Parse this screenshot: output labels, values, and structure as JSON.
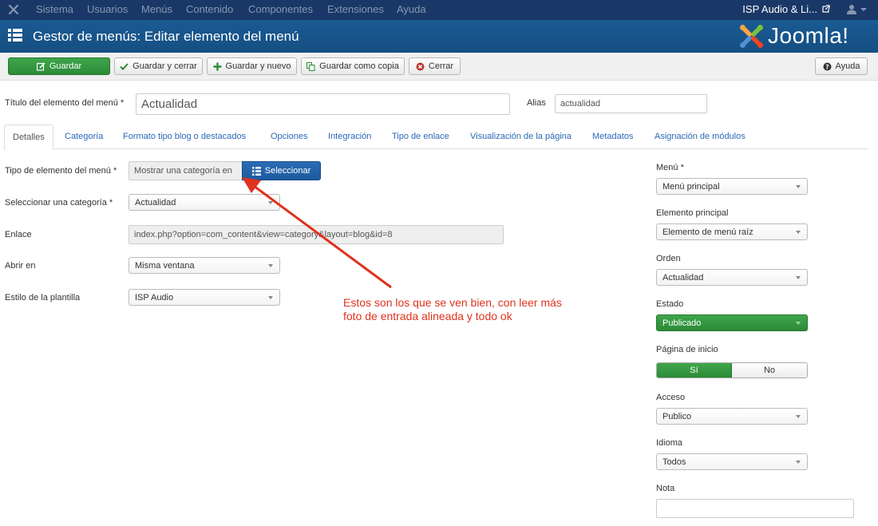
{
  "topnav": {
    "items": [
      "Sistema",
      "Usuarios",
      "Menús",
      "Contenido",
      "Componentes",
      "Extensiones",
      "Ayuda"
    ],
    "site_link": "ISP Audio & Li..."
  },
  "header": {
    "title": "Gestor de menús: Editar elemento del menú",
    "brand": "Joomla!"
  },
  "toolbar": {
    "save": "Guardar",
    "save_close": "Guardar y cerrar",
    "save_new": "Guardar y nuevo",
    "save_copy": "Guardar como copia",
    "close": "Cerrar",
    "help": "Ayuda"
  },
  "form": {
    "title_label": "Título del elemento del menú *",
    "title_value": "Actualidad",
    "alias_label": "Alias",
    "alias_value": "actualidad"
  },
  "tabs": [
    "Detalles",
    "Categoría",
    "Formato tipo blog o destacados",
    "Opciones",
    "Integración",
    "Tipo de enlace",
    "Visualización de la página",
    "Metadatos",
    "Asignación de módulos"
  ],
  "details": {
    "type_label": "Tipo de elemento del menú *",
    "type_value": "Mostrar una categoría en",
    "select_button": "Seleccionar",
    "category_label": "Seleccionar una categoría *",
    "category_value": "Actualidad",
    "link_label": "Enlace",
    "link_value": "index.php?option=com_content&view=category&layout=blog&id=8",
    "open_label": "Abrir en",
    "open_value": "Misma ventana",
    "template_label": "Estilo de la plantilla",
    "template_value": "ISP Audio"
  },
  "sidebar": {
    "menu_label": "Menú *",
    "menu_value": "Menú principal",
    "parent_label": "Elemento principal",
    "parent_value": "Elemento de menú raíz",
    "order_label": "Orden",
    "order_value": "Actualidad",
    "status_label": "Estado",
    "status_value": "Publicado",
    "home_label": "Página de inicio",
    "home_yes": "Sí",
    "home_no": "No",
    "access_label": "Acceso",
    "access_value": "Publico",
    "lang_label": "Idioma",
    "lang_value": "Todos",
    "note_label": "Nota",
    "note_value": ""
  },
  "annotation": {
    "line1": "Estos son los que se ven bien, con leer más",
    "line2": "foto de entrada alineada y todo ok"
  },
  "colors": {
    "nav": "#1a3867",
    "header": "#17568c",
    "green": "#2d8a38",
    "link": "#2a69b8",
    "annotation": "#e0321e"
  }
}
